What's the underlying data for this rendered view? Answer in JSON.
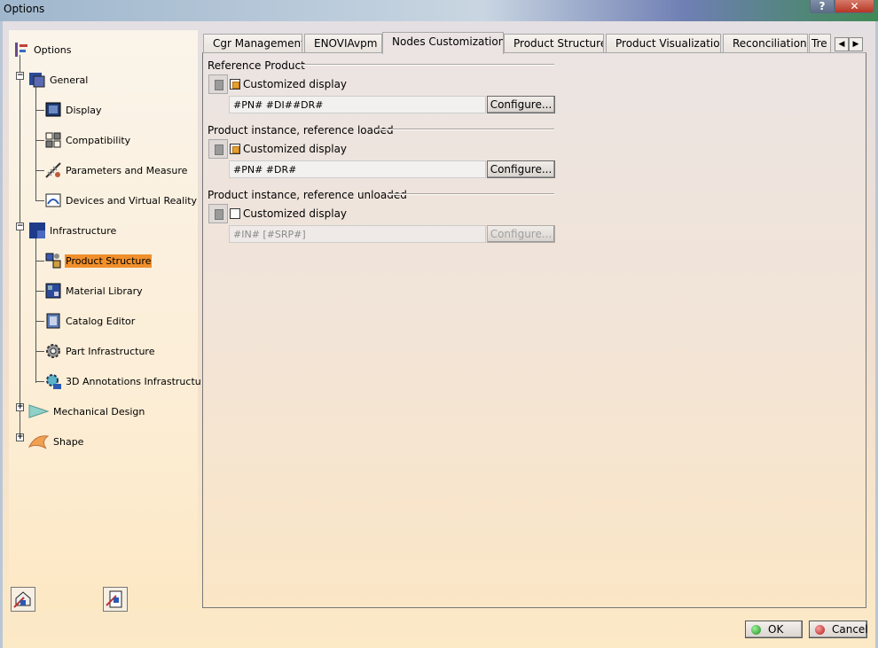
{
  "window": {
    "title": "Options",
    "help_label": "?",
    "close_label": "✕"
  },
  "tree": {
    "root": "Options",
    "items": [
      {
        "label": "General",
        "icon": "general-icon"
      },
      {
        "label": "Display",
        "icon": "display-icon"
      },
      {
        "label": "Compatibility",
        "icon": "compatibility-icon"
      },
      {
        "label": "Parameters and Measure",
        "icon": "parameters-measure-icon"
      },
      {
        "label": "Devices and Virtual Reality",
        "icon": "devices-vr-icon"
      },
      {
        "label": "Infrastructure",
        "icon": "infrastructure-icon"
      },
      {
        "label": "Product Structure",
        "icon": "product-structure-icon",
        "selected": true
      },
      {
        "label": "Material Library",
        "icon": "material-library-icon"
      },
      {
        "label": "Catalog Editor",
        "icon": "catalog-editor-icon"
      },
      {
        "label": "Part Infrastructure",
        "icon": "part-infrastructure-icon"
      },
      {
        "label": "3D Annotations Infrastructu",
        "icon": "annotations-3d-icon"
      },
      {
        "label": "Mechanical Design",
        "icon": "mechanical-design-icon"
      },
      {
        "label": "Shape",
        "icon": "shape-icon"
      }
    ]
  },
  "tabs": [
    {
      "label": "Cgr Management"
    },
    {
      "label": "ENOVIAvpm"
    },
    {
      "label": "Nodes Customization",
      "active": true
    },
    {
      "label": "Product Structure"
    },
    {
      "label": "Product Visualization"
    },
    {
      "label": "Reconciliation"
    },
    {
      "label": "Tre"
    }
  ],
  "sections": [
    {
      "title": "Reference Product",
      "checkbox_label": "Customized display",
      "checked": true,
      "value": "#PN# #DI##DR#",
      "button": "Configure...",
      "enabled": true
    },
    {
      "title": "Product instance, reference loaded",
      "checkbox_label": "Customized display",
      "checked": true,
      "value": "#PN#  #DR#",
      "button": "Configure...",
      "enabled": true
    },
    {
      "title": "Product instance, reference unloaded",
      "checkbox_label": "Customized display",
      "checked": false,
      "value": "#IN# [#SRP#]",
      "button": "Configure...",
      "enabled": false
    }
  ],
  "footer": {
    "ok_label": "OK",
    "cancel_label": "Cancel"
  },
  "colors": {
    "selection": "#f08f2c",
    "checkbox_fill": "#e3a030"
  }
}
